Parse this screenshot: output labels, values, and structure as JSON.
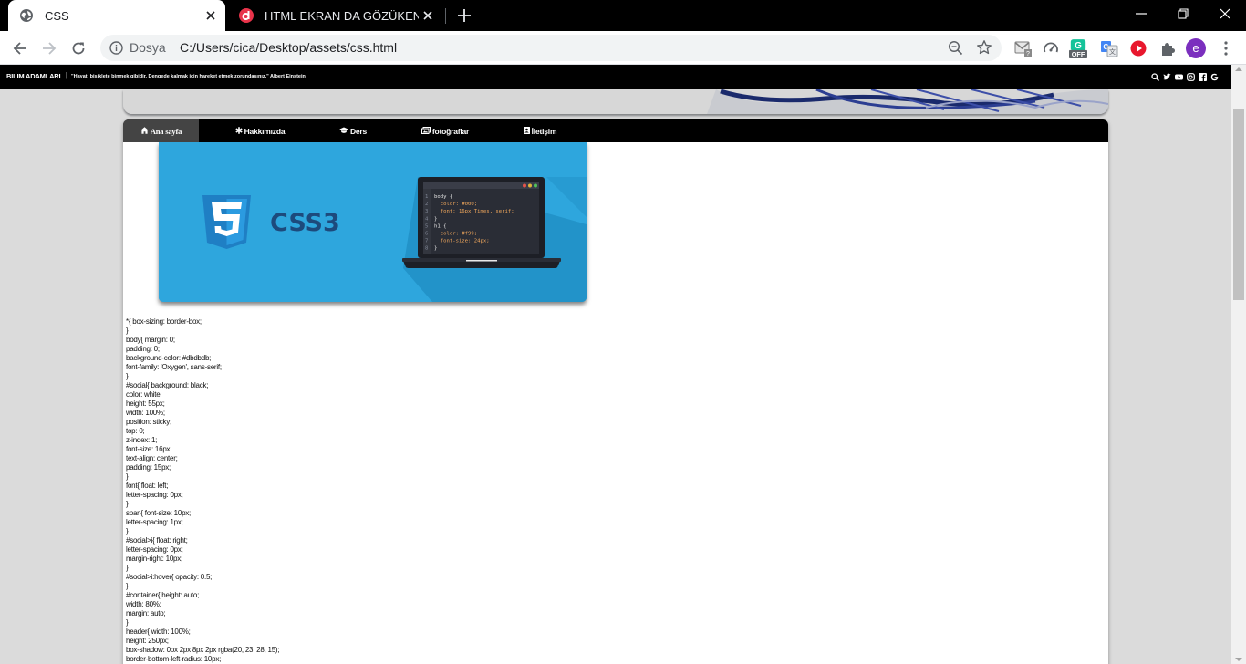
{
  "browser": {
    "tabs": [
      {
        "title": "CSS",
        "favicon": "globe-icon",
        "active": true
      },
      {
        "title": "HTML EKRAN DA GÖZÜKEN AMA",
        "favicon": "dailymotion-icon",
        "active": false
      }
    ],
    "omnibox": {
      "origin_label": "Dosya",
      "url": "C:/Users/cica/Desktop/assets/css.html"
    },
    "extensions": [
      "gmail-icon",
      "speedometer-icon",
      "grammarly-off-icon",
      "translate-icon",
      "record-icon",
      "puzzle-icon",
      "profile-avatar",
      "more-icon"
    ],
    "badges": {
      "grammarly": "OFF"
    },
    "profile_initial": "e",
    "accent": "#7b2fbe"
  },
  "social": {
    "brand": "BILIM ADAMLARI",
    "quote": "\"Hayat, bisiklete binmek gibidir. Dengede kalmak için hareket etmek zorundasınız.\" Albert Einstein",
    "icons": [
      "search-icon",
      "twitter-icon",
      "youtube-icon",
      "instagram-icon",
      "facebook-icon",
      "google-icon"
    ]
  },
  "menu": {
    "items": [
      {
        "label": "Ana sayfa",
        "icon": "home-icon",
        "glyph": "⌂",
        "active": true
      },
      {
        "label": "Hakkımızda",
        "icon": "asterisk-icon",
        "glyph": "✱",
        "active": false
      },
      {
        "label": "Ders",
        "icon": "graduation-cap-icon",
        "glyph": "🎓",
        "active": false
      },
      {
        "label": "fotoğraflar",
        "icon": "images-icon",
        "glyph": "▣",
        "active": false
      },
      {
        "label": "İletişim",
        "icon": "contact-card-icon",
        "glyph": "▪",
        "active": false
      }
    ]
  },
  "banner": {
    "logo_number": "3",
    "title": "CSS3",
    "code_lines": [
      {
        "n": "1",
        "text": "body {"
      },
      {
        "n": "2",
        "text": "  color: #000;"
      },
      {
        "n": "3",
        "text": "  font: 16px Times, serif;"
      },
      {
        "n": "4",
        "text": "}"
      },
      {
        "n": "5",
        "text": "h1 {"
      },
      {
        "n": "6",
        "text": "  color: #f99;"
      },
      {
        "n": "7",
        "text": "  font-size: 24px;"
      },
      {
        "n": "8",
        "text": "}"
      }
    ],
    "colors": {
      "background": "#2ea6dd",
      "shield": "#1f7fc4",
      "laptop": "#1d1f26"
    }
  },
  "code_text": "*{ box-sizing: border-box;\n}\nbody{ margin: 0;\npadding: 0;\nbackground-color: #dbdbdb;\nfont-family: 'Oxygen', sans-serif;\n}\n#social{ background: black;\ncolor: white;\nheight: 55px;\nwidth: 100%;\nposition: sticky;\ntop: 0;\nz-index: 1;\nfont-size: 16px;\ntext-align: center;\npadding: 15px;\n}\nfont{ float: left;\nletter-spacing: 0px;\n}\nspan{ font-size: 10px;\nletter-spacing: 1px;\n}\n#social>i{ float: right;\nletter-spacing: 0px;\nmargin-right: 10px;\n}\n#social>i:hover{ opacity: 0.5;\n}\n#container{ height: auto;\nwidth: 80%;\nmargin: auto;\n}\nheader{ width: 100%;\nheight: 250px;\nbox-shadow: 0px 2px 8px 2px rgba(20, 23, 28, 15);\nborder-bottom-left-radius: 10px;"
}
